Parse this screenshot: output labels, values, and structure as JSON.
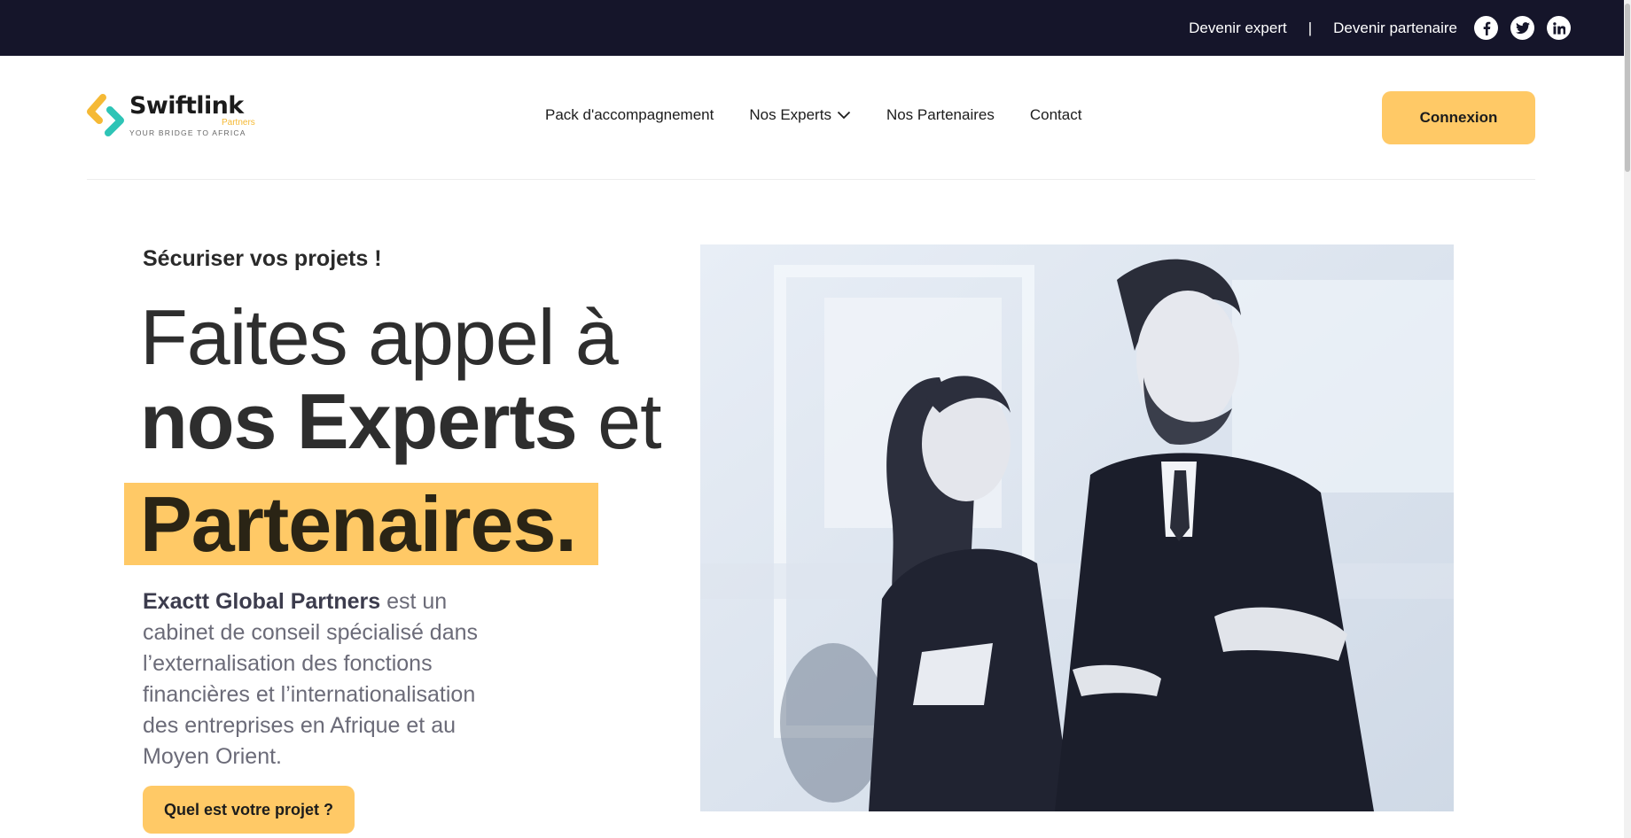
{
  "topbar": {
    "become_expert": "Devenir expert",
    "separator": "|",
    "become_partner": "Devenir partenaire",
    "social": [
      "facebook-icon",
      "twitter-icon",
      "linkedin-icon"
    ]
  },
  "logo": {
    "name": "Swiftlink",
    "sub": "Partners",
    "tagline": "YOUR BRIDGE TO AFRICA"
  },
  "nav": {
    "items": [
      "Pack d'accompagnement",
      "Nos Experts",
      "Nos Partenaires",
      "Contact"
    ]
  },
  "header": {
    "login_label": "Connexion"
  },
  "hero": {
    "kicker": "Sécuriser vos projets !",
    "line1": "Faites appel à",
    "line2_bold": "nos Experts",
    "line2_rest": " et",
    "line3": "Partenaires.",
    "desc_bold": "Exactt Global Partners",
    "desc_rest": " est un cabinet de conseil spécialisé dans l’externalisation des fonctions financières et l’internationalisation des entreprises en Afrique et au Moyen Orient.",
    "cta_label": "Quel est votre projet ?"
  },
  "colors": {
    "accent": "#ffc966",
    "topbar": "#15152a",
    "logo_orange": "#f5b935",
    "logo_teal": "#2ec4b6"
  }
}
